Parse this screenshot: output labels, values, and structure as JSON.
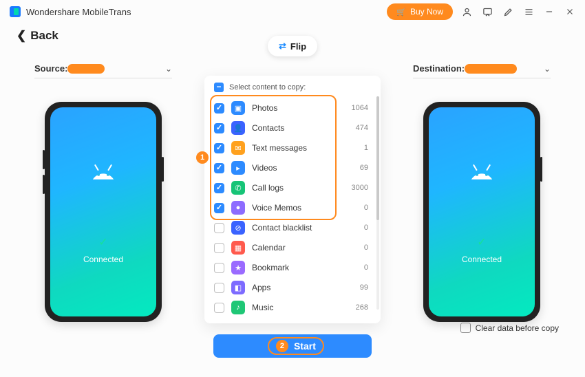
{
  "app": {
    "title": "Wondershare MobileTrans",
    "buy": "Buy Now"
  },
  "back": "Back",
  "flip": "Flip",
  "source": {
    "label": "Source:",
    "redact_w": 54
  },
  "destination": {
    "label": "Destination:",
    "redact_w": 76
  },
  "phone": {
    "status": "Connected"
  },
  "panel": {
    "title": "Select content to copy:",
    "items": [
      {
        "name": "Photos",
        "count": 1064,
        "checked": true,
        "color": "#2d8bff",
        "glyph": "▣"
      },
      {
        "name": "Contacts",
        "count": 474,
        "checked": true,
        "color": "#3a63ff",
        "glyph": "👤"
      },
      {
        "name": "Text messages",
        "count": 1,
        "checked": true,
        "color": "#ffa11e",
        "glyph": "✉"
      },
      {
        "name": "Videos",
        "count": 69,
        "checked": true,
        "color": "#2d8bff",
        "glyph": "▸"
      },
      {
        "name": "Call logs",
        "count": 3000,
        "checked": true,
        "color": "#17c477",
        "glyph": "✆"
      },
      {
        "name": "Voice Memos",
        "count": 0,
        "checked": true,
        "color": "#8d6cff",
        "glyph": "●"
      },
      {
        "name": "Contact blacklist",
        "count": 0,
        "checked": false,
        "color": "#3a63ff",
        "glyph": "⊘"
      },
      {
        "name": "Calendar",
        "count": 0,
        "checked": false,
        "color": "#ff5a4d",
        "glyph": "▦"
      },
      {
        "name": "Bookmark",
        "count": 0,
        "checked": false,
        "color": "#9a6bff",
        "glyph": "★"
      },
      {
        "name": "Apps",
        "count": 99,
        "checked": false,
        "color": "#7d6bff",
        "glyph": "◧"
      },
      {
        "name": "Music",
        "count": 268,
        "checked": false,
        "color": "#1fc776",
        "glyph": "♪"
      }
    ]
  },
  "start": "Start",
  "clear": "Clear data before copy",
  "callouts": {
    "one": "1",
    "two": "2"
  }
}
